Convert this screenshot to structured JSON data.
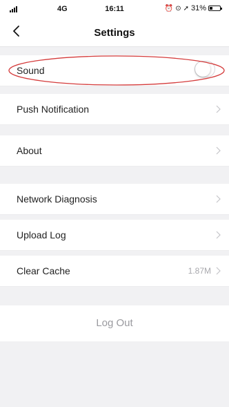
{
  "status_bar": {
    "network": "4G",
    "time": "16:11",
    "battery_text": "31%",
    "battery_level": 0.31
  },
  "nav": {
    "title": "Settings",
    "back_icon": "chevron-left-icon"
  },
  "sections": [
    {
      "items": [
        {
          "label": "Sound",
          "type": "toggle",
          "enabled": false
        },
        {
          "label": "Push Notification",
          "type": "link"
        }
      ]
    },
    {
      "items": [
        {
          "label": "About",
          "type": "link"
        }
      ]
    },
    {
      "items": [
        {
          "label": "Network Diagnosis",
          "type": "link"
        },
        {
          "label": "Upload Log",
          "type": "link"
        },
        {
          "label": "Clear Cache",
          "type": "link",
          "value": "1.87M"
        }
      ]
    }
  ],
  "logout_label": "Log Out",
  "colors": {
    "annotation": "#d43a3a",
    "background": "#f1f1f3",
    "muted_text": "#9a9a9f"
  }
}
